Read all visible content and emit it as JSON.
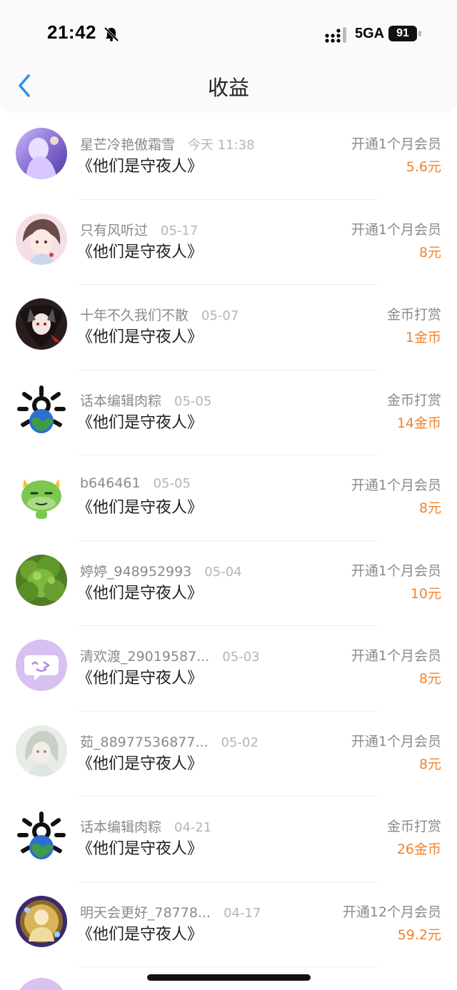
{
  "status_bar": {
    "time": "21:42",
    "network": "5GA",
    "battery": "91"
  },
  "header": {
    "title": "收益",
    "back_icon": "chevron-left-icon",
    "accent": "#2f8ee8"
  },
  "colors": {
    "amount": "#f0832d",
    "muted": "#8a8a8a"
  },
  "rows": [
    {
      "name": "星芒冷艳傲霜雪",
      "date": "今天 11:38",
      "book": "《他们是守夜人》",
      "type": "开通1个月会员",
      "amount": "5.6元",
      "avatar": "avatar-anime-purple"
    },
    {
      "name": "只有风听过",
      "date": "05-17",
      "book": "《他们是守夜人》",
      "type": "开通1个月会员",
      "amount": "8元",
      "avatar": "avatar-anime-girl"
    },
    {
      "name": "十年不久我们不散",
      "date": "05-07",
      "book": "《他们是守夜人》",
      "type": "金币打赏",
      "amount": "1金币",
      "avatar": "avatar-dark-anime"
    },
    {
      "name": "话本编辑肉粽",
      "date": "05-05",
      "book": "《他们是守夜人》",
      "type": "金币打赏",
      "amount": "14金币",
      "avatar": "avatar-earth-bones"
    },
    {
      "name": "b646461",
      "date": "05-05",
      "book": "《他们是守夜人》",
      "type": "开通1个月会员",
      "amount": "8元",
      "avatar": "avatar-green-dragon"
    },
    {
      "name": "婷婷_948952993",
      "date": "05-04",
      "book": "《他们是守夜人》",
      "type": "开通1个月会员",
      "amount": "10元",
      "avatar": "avatar-green-plant"
    },
    {
      "name": "清欢渡_29019587...",
      "date": "05-03",
      "book": "《他们是守夜人》",
      "type": "开通1个月会员",
      "amount": "8元",
      "avatar": "avatar-chat-bubble"
    },
    {
      "name": "茹_88977536877...",
      "date": "05-02",
      "book": "《他们是守夜人》",
      "type": "开通1个月会员",
      "amount": "8元",
      "avatar": "avatar-pale-girl"
    },
    {
      "name": "话本编辑肉粽",
      "date": "04-21",
      "book": "《他们是守夜人》",
      "type": "金币打赏",
      "amount": "26金币",
      "avatar": "avatar-earth-bones"
    },
    {
      "name": "明天会更好_78778...",
      "date": "04-17",
      "book": "《他们是守夜人》",
      "type": "开通12个月会员",
      "amount": "59.2元",
      "avatar": "avatar-golden-figure"
    }
  ]
}
